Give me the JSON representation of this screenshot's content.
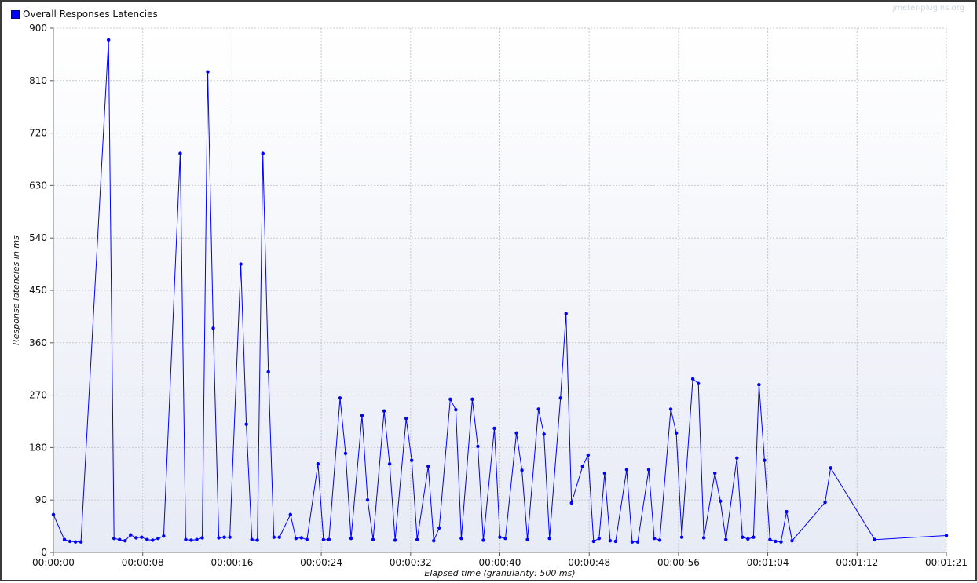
{
  "watermark": "jmeter-plugins.org",
  "colors": {
    "series": "#0000ff",
    "grid": "#c8c8c8"
  },
  "chart_data": {
    "type": "line",
    "title": "",
    "xlabel": "Elapsed time (granularity: 500 ms)",
    "ylabel": "Response latencies in ms",
    "xlim": [
      0,
      81
    ],
    "ylim": [
      0,
      900
    ],
    "x_tick_labels": [
      "00:00:00",
      "00:00:08",
      "00:00:16",
      "00:00:24",
      "00:00:32",
      "00:00:40",
      "00:00:48",
      "00:00:56",
      "00:01:04",
      "00:01:12",
      "00:01:21"
    ],
    "y_tick_labels": [
      "0",
      "90",
      "180",
      "270",
      "360",
      "450",
      "540",
      "630",
      "720",
      "810",
      "900"
    ],
    "grid": true,
    "legend": "top-left",
    "series": [
      {
        "name": "Overall Responses Latencies",
        "points": [
          [
            0.0,
            65
          ],
          [
            1.0,
            22
          ],
          [
            1.5,
            19
          ],
          [
            2.0,
            18
          ],
          [
            2.5,
            18
          ],
          [
            5.0,
            880
          ],
          [
            5.5,
            24
          ],
          [
            6.0,
            22
          ],
          [
            6.5,
            20
          ],
          [
            7.0,
            30
          ],
          [
            7.5,
            25
          ],
          [
            8.0,
            26
          ],
          [
            8.5,
            22
          ],
          [
            9.0,
            21
          ],
          [
            9.5,
            24
          ],
          [
            10.0,
            28
          ],
          [
            11.5,
            685
          ],
          [
            12.0,
            22
          ],
          [
            12.5,
            21
          ],
          [
            13.0,
            22
          ],
          [
            13.5,
            25
          ],
          [
            14.0,
            825
          ],
          [
            14.5,
            385
          ],
          [
            15.0,
            25
          ],
          [
            15.5,
            26
          ],
          [
            16.0,
            26
          ],
          [
            17.0,
            495
          ],
          [
            17.5,
            220
          ],
          [
            18.0,
            22
          ],
          [
            18.5,
            21
          ],
          [
            19.0,
            685
          ],
          [
            19.5,
            310
          ],
          [
            20.0,
            26
          ],
          [
            20.5,
            26
          ],
          [
            21.5,
            65
          ],
          [
            22.0,
            24
          ],
          [
            22.5,
            25
          ],
          [
            23.0,
            22
          ],
          [
            24.0,
            152
          ],
          [
            24.5,
            22
          ],
          [
            25.0,
            22
          ],
          [
            26.0,
            265
          ],
          [
            26.5,
            170
          ],
          [
            27.0,
            24
          ],
          [
            28.0,
            235
          ],
          [
            28.5,
            90
          ],
          [
            29.0,
            22
          ],
          [
            30.0,
            243
          ],
          [
            30.5,
            152
          ],
          [
            31.0,
            21
          ],
          [
            32.0,
            230
          ],
          [
            32.5,
            158
          ],
          [
            33.0,
            22
          ],
          [
            34.0,
            148
          ],
          [
            34.5,
            20
          ],
          [
            35.0,
            42
          ],
          [
            36.0,
            263
          ],
          [
            36.5,
            245
          ],
          [
            37.0,
            24
          ],
          [
            38.0,
            263
          ],
          [
            38.5,
            182
          ],
          [
            39.0,
            21
          ],
          [
            40.0,
            213
          ],
          [
            40.5,
            26
          ],
          [
            41.0,
            24
          ],
          [
            42.0,
            205
          ],
          [
            42.5,
            141
          ],
          [
            43.0,
            22
          ],
          [
            44.0,
            246
          ],
          [
            44.5,
            203
          ],
          [
            45.0,
            24
          ],
          [
            46.0,
            265
          ],
          [
            46.5,
            410
          ],
          [
            47.0,
            85
          ],
          [
            48.0,
            148
          ],
          [
            48.5,
            167
          ],
          [
            49.0,
            19
          ],
          [
            49.5,
            24
          ],
          [
            50.0,
            136
          ],
          [
            50.5,
            20
          ],
          [
            51.0,
            19
          ],
          [
            52.0,
            142
          ],
          [
            52.5,
            18
          ],
          [
            53.0,
            18
          ],
          [
            54.0,
            142
          ],
          [
            54.5,
            24
          ],
          [
            55.0,
            21
          ],
          [
            56.0,
            246
          ],
          [
            56.5,
            205
          ],
          [
            57.0,
            26
          ],
          [
            58.0,
            298
          ],
          [
            58.5,
            290
          ],
          [
            59.0,
            25
          ],
          [
            60.0,
            136
          ],
          [
            60.5,
            88
          ],
          [
            61.0,
            22
          ],
          [
            62.0,
            162
          ],
          [
            62.5,
            26
          ],
          [
            63.0,
            23
          ],
          [
            63.5,
            26
          ],
          [
            64.0,
            288
          ],
          [
            64.5,
            158
          ],
          [
            65.0,
            22
          ],
          [
            65.5,
            19
          ],
          [
            66.0,
            18
          ],
          [
            66.5,
            70
          ],
          [
            67.0,
            20
          ],
          [
            70.0,
            86
          ],
          [
            70.5,
            145
          ],
          [
            74.5,
            22
          ],
          [
            81.0,
            29
          ]
        ]
      }
    ]
  }
}
